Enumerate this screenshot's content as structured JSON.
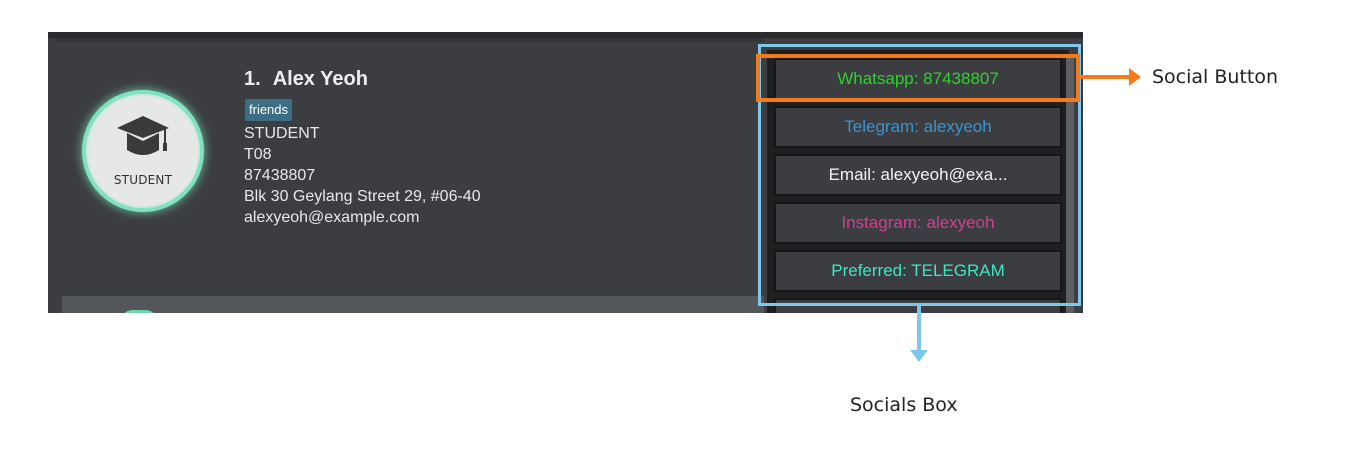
{
  "card": {
    "index": "1.",
    "name": "Alex Yeoh",
    "tag": "friends",
    "avatar_label": "STUDENT",
    "avatar_icon": "graduation-cap-icon",
    "fields": [
      "STUDENT",
      "T08",
      "87438807",
      "Blk 30 Geylang Street 29, #06-40",
      "alexyeoh@example.com"
    ]
  },
  "socials": [
    {
      "label": "Whatsapp: 87438807",
      "color": "#2ed12e"
    },
    {
      "label": "Telegram: alexyeoh",
      "color": "#3a94cf"
    },
    {
      "label": "Email: alexyeoh@exa...",
      "color": "#f2f2f2"
    },
    {
      "label": "Instagram: alexyeoh",
      "color": "#d03f93"
    },
    {
      "label": "Preferred: TELEGRAM",
      "color": "#3ee6c4"
    }
  ],
  "annotations": {
    "social_button": "Social Button",
    "socials_box": "Socials Box",
    "social_button_color": "#f47a1a",
    "socials_box_color": "#7ec7ec"
  },
  "theme": {
    "window_bg": "#3c3d40",
    "avatar_ring": "#7fe3c0",
    "tag_bg": "#3c6e86"
  }
}
